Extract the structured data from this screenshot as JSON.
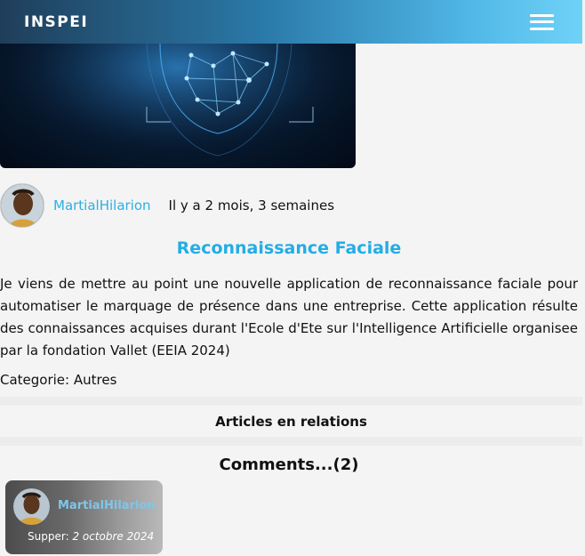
{
  "navbar": {
    "brand": "INSPEI",
    "menu_icon": "hamburger-menu-icon",
    "colors": {
      "start": "#1f3e5a",
      "end": "#6fd2f7"
    }
  },
  "hero": {
    "image": "facial-recognition-illustration"
  },
  "post": {
    "author": "MartialHilarion",
    "time_ago": "Il y a 2 mois, 3 semaines",
    "title": "Reconnaissance Faciale",
    "body": "Je viens de mettre au point une nouvelle application de reconnaissance faciale pour automatiser le marquage de présence dans une entreprise. Cette application résulte des connaissances acquises durant l'Ecole d'Ete sur l'Intelligence Artificielle organisee par la fondation Vallet (EEIA 2024)",
    "category": "Categorie: Autres",
    "title_color": "#23ade6",
    "author_color": "#2bb0e4"
  },
  "related": {
    "label": "Articles en relations"
  },
  "comments": {
    "title": "Comments...(2)",
    "items": [
      {
        "author": "MartialHilarion",
        "date_prefix": "Supper:",
        "date": "2 octobre 2024"
      }
    ]
  }
}
